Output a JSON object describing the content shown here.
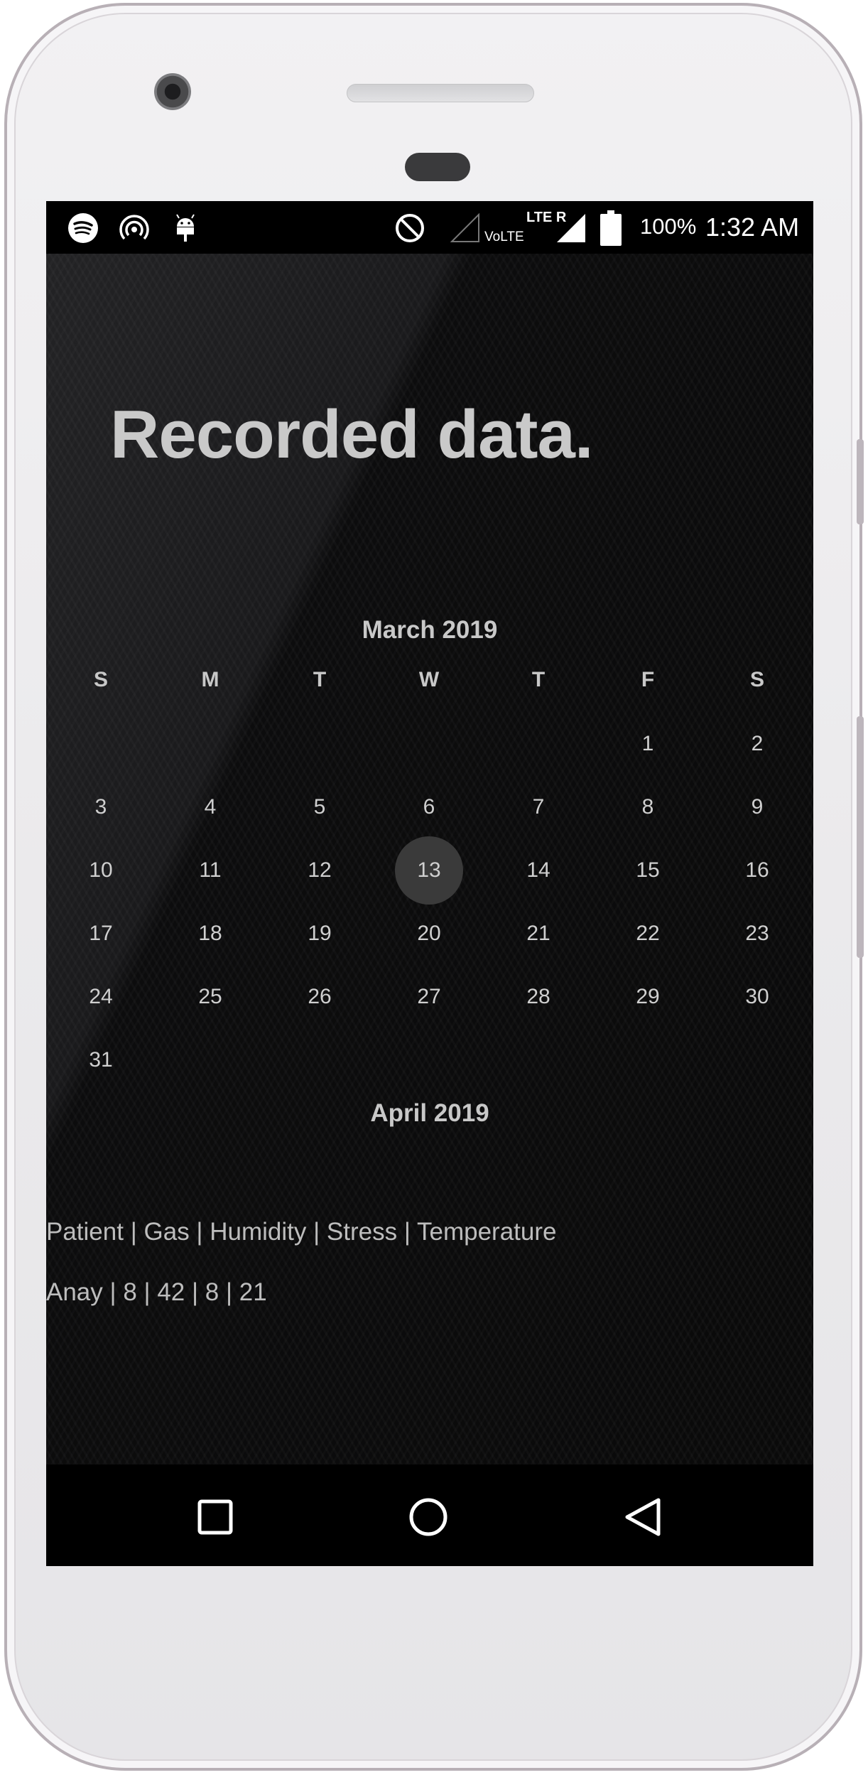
{
  "status_bar": {
    "battery": "100%",
    "time": "1:32 AM",
    "network_label": "LTE R",
    "volte_label": "VoLTE",
    "icons": [
      "spotify-icon",
      "hotspot-icon",
      "android-debug-icon",
      "do-not-disturb-icon",
      "signal-empty-icon",
      "signal-full-icon",
      "battery-icon"
    ]
  },
  "page": {
    "title": "Recorded data."
  },
  "calendar": {
    "month_title": "March 2019",
    "next_month_title": "April 2019",
    "weekdays": [
      "S",
      "M",
      "T",
      "W",
      "T",
      "F",
      "S"
    ],
    "weeks": [
      [
        "",
        "",
        "",
        "",
        "",
        "1",
        "2"
      ],
      [
        "3",
        "4",
        "5",
        "6",
        "7",
        "8",
        "9"
      ],
      [
        "10",
        "11",
        "12",
        "13",
        "14",
        "15",
        "16"
      ],
      [
        "17",
        "18",
        "19",
        "20",
        "21",
        "22",
        "23"
      ],
      [
        "24",
        "25",
        "26",
        "27",
        "28",
        "29",
        "30"
      ],
      [
        "31",
        "",
        "",
        "",
        "",
        "",
        ""
      ]
    ],
    "selected_day": "13"
  },
  "records": {
    "header": "Patient | Gas | Humidity | Stress | Temperature",
    "rows": [
      "Anay | 8 | 42 | 8 | 21"
    ]
  },
  "navigation": {
    "icons": [
      "recents-square-icon",
      "home-circle-icon",
      "back-triangle-icon"
    ]
  }
}
